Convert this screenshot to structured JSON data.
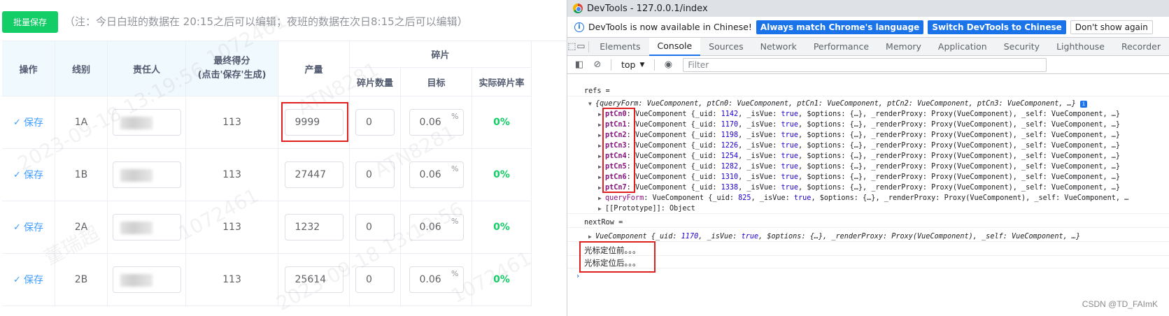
{
  "left": {
    "batch_save_label": "批量保存",
    "note": "（注：今日白班的数据在 20:15之后可以编辑；夜班的数据在次日8:15之后可以编辑）",
    "headers": {
      "op": "操作",
      "line": "线别",
      "owner": "责任人",
      "final_score": "最终得分",
      "final_score_sub": "(点击'保存'生成)",
      "output": "产量",
      "scrap": "碎片",
      "scrap_count": "碎片数量",
      "target": "目标",
      "actual_rate": "实际碎片率"
    },
    "rows": [
      {
        "save": "保存",
        "line": "1A",
        "score": "113",
        "output": "9999",
        "scrap": "0",
        "target": "0.06",
        "rate": "0%"
      },
      {
        "save": "保存",
        "line": "1B",
        "score": "113",
        "output": "27447",
        "scrap": "0",
        "target": "0.06",
        "rate": "0%"
      },
      {
        "save": "保存",
        "line": "2A",
        "score": "113",
        "output": "1232",
        "scrap": "0",
        "target": "0.06",
        "rate": "0%"
      },
      {
        "save": "保存",
        "line": "2B",
        "score": "113",
        "output": "25614",
        "scrap": "0",
        "target": "0.06",
        "rate": "0%"
      }
    ],
    "pct_unit": "%",
    "watermarks": [
      "1072461",
      "ATN8281",
      "2023-09-18 13:19:56",
      "董瑞超"
    ]
  },
  "devtools": {
    "title": "DevTools - 127.0.0.1/index",
    "info_text": "DevTools is now available in Chinese!",
    "btn_match": "Always match Chrome's language",
    "btn_switch": "Switch DevTools to Chinese",
    "btn_dismiss": "Don't show again",
    "tabs": [
      "Elements",
      "Console",
      "Sources",
      "Network",
      "Performance",
      "Memory",
      "Application",
      "Security",
      "Lighthouse",
      "Recorder"
    ],
    "active_tab": "Console",
    "context": "top",
    "filter_placeholder": "Filter",
    "refs_label": "refs =",
    "refs_summary": "{queryForm: VueComponent, ptCn0: VueComponent, ptCn1: VueComponent, ptCn2: VueComponent, ptCn3: VueComponent, …}",
    "ptcn": [
      {
        "key": "ptCn0",
        "uid": "1142"
      },
      {
        "key": "ptCn1",
        "uid": "1170"
      },
      {
        "key": "ptCn2",
        "uid": "1198"
      },
      {
        "key": "ptCn3",
        "uid": "1226"
      },
      {
        "key": "ptCn4",
        "uid": "1254"
      },
      {
        "key": "ptCn5",
        "uid": "1282"
      },
      {
        "key": "ptCn6",
        "uid": "1310"
      },
      {
        "key": "ptCn7",
        "uid": "1338"
      }
    ],
    "query_form_key": "queryForm",
    "query_form_uid": "825",
    "prototype_line": "[[Prototype]]: Object",
    "next_row_label": "nextRow =",
    "next_row_uid": "1170",
    "log_before": "光标定位前。。。",
    "log_after": "光标定位后。。。",
    "footer": "CSDN @TD_FAImK"
  },
  "colors": {
    "green": "#13ce66",
    "link_blue": "#409eff",
    "highlight_red": "#e01f1f",
    "devtools_blue": "#1a73e8"
  }
}
